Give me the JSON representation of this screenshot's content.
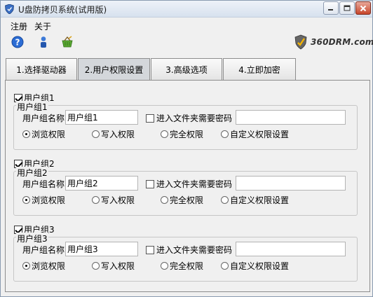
{
  "window": {
    "title": "U盘防拷贝系统(试用版)",
    "brand": "360DRM.com"
  },
  "menu": {
    "items": [
      "注册",
      "关于"
    ]
  },
  "toolbar": {
    "icons": [
      "help-icon",
      "user-icon",
      "basket-icon"
    ]
  },
  "tabs": [
    {
      "label": "1.选择驱动器",
      "active": false
    },
    {
      "label": "2.用户权限设置",
      "active": true
    },
    {
      "label": "3.高级选项",
      "active": false
    },
    {
      "label": "4.立即加密",
      "active": false
    }
  ],
  "groups": [
    {
      "checkbox_label": "用户组1",
      "checked": true,
      "legend": "用户组1",
      "name_label": "用户组名称",
      "name_value": "用户组1",
      "password_label": "进入文件夹需要密码",
      "password_checked": false,
      "password_value": "",
      "permissions": [
        "浏览权限",
        "写入权限",
        "完全权限",
        "自定义权限设置"
      ],
      "selected_permission": "浏览权限"
    },
    {
      "checkbox_label": "用户组2",
      "checked": true,
      "legend": "用户组2",
      "name_label": "用户组名称",
      "name_value": "用户组2",
      "password_label": "进入文件夹需要密码",
      "password_checked": false,
      "password_value": "",
      "permissions": [
        "浏览权限",
        "写入权限",
        "完全权限",
        "自定义权限设置"
      ],
      "selected_permission": "浏览权限"
    },
    {
      "checkbox_label": "用户组3",
      "checked": true,
      "legend": "用户组3",
      "name_label": "用户组名称",
      "name_value": "用户组3",
      "password_label": "进入文件夹需要密码",
      "password_checked": false,
      "password_value": "",
      "permissions": [
        "浏览权限",
        "写入权限",
        "完全权限",
        "自定义权限设置"
      ],
      "selected_permission": "浏览权限"
    }
  ]
}
